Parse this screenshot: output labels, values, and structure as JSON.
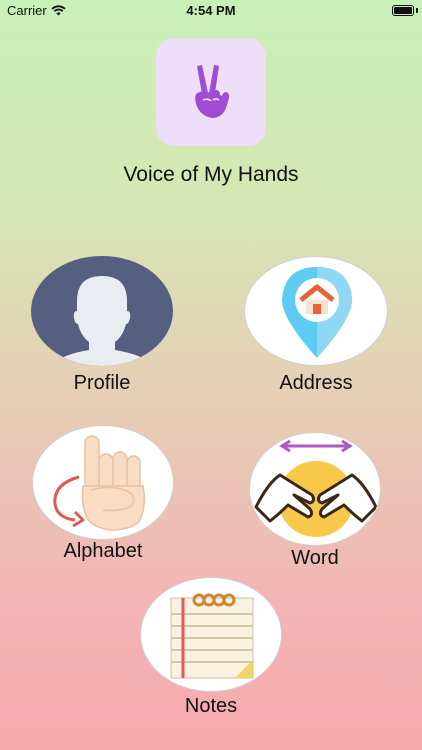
{
  "status_bar": {
    "carrier": "Carrier",
    "time": "4:54 PM",
    "wifi_icon": "wifi-icon",
    "battery_icon": "battery-icon"
  },
  "app": {
    "title": "Voice of My Hands",
    "logo_icon": "victory-hand-icon",
    "logo_bg": "#efdef9",
    "logo_color": "#a04bd3"
  },
  "menu": {
    "profile": {
      "label": "Profile",
      "icon": "person-silhouette-icon"
    },
    "address": {
      "label": "Address",
      "icon": "home-location-pin-icon"
    },
    "alphabet": {
      "label": "Alphabet",
      "icon": "finger-spelling-hand-icon"
    },
    "word": {
      "label": "Word",
      "icon": "signing-hands-icon"
    },
    "notes": {
      "label": "Notes",
      "icon": "notepad-icon"
    }
  },
  "colors": {
    "gradient_top": "#c9f0b8",
    "gradient_bottom": "#f7a9ae",
    "profile_circle": "#555f7f",
    "pin_blue": "#5ecbf3",
    "roof_orange": "#e8613c",
    "arrow_purple": "#b05ac0",
    "sun_yellow": "#f7c84a"
  }
}
